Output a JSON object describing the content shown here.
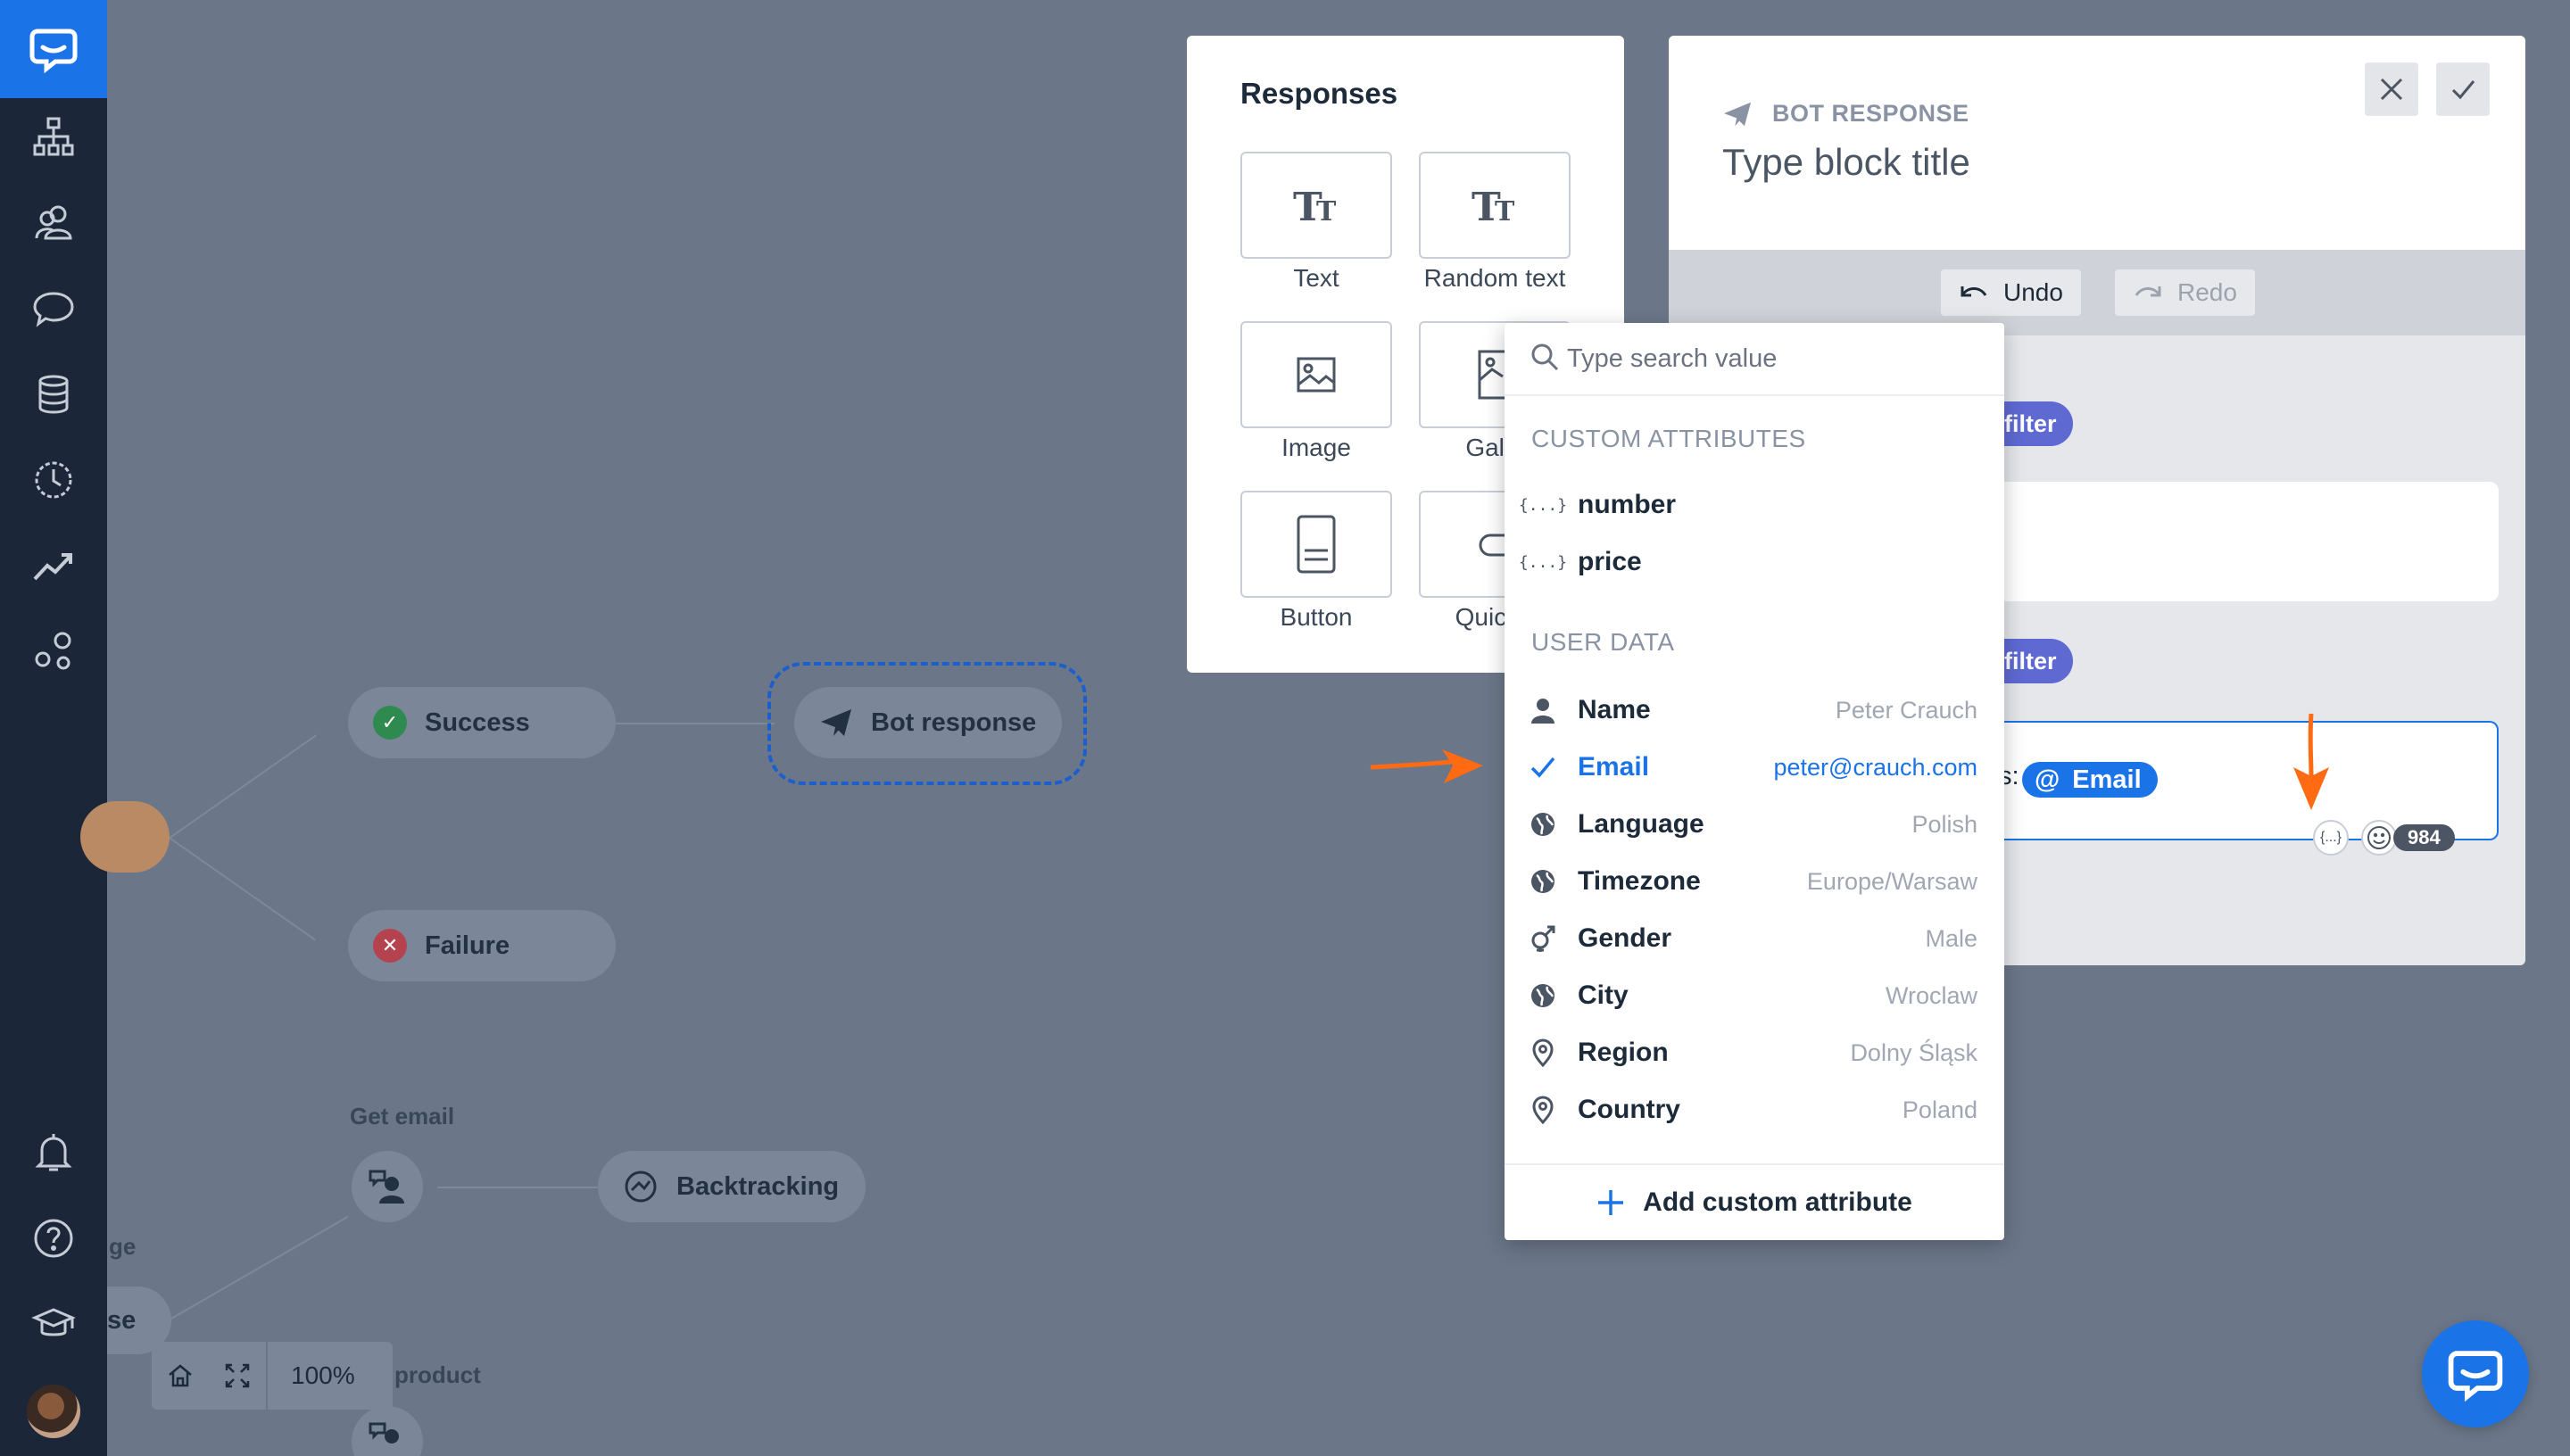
{
  "canvas": {
    "nodes": {
      "success": "Success",
      "failure": "Failure",
      "bot_response": "Bot response",
      "backtracking": "Backtracking"
    },
    "labels": {
      "get_email": "Get email",
      "product": "product",
      "ge": "ge",
      "se": "se"
    },
    "zoom": "100%"
  },
  "responses": {
    "title": "Responses",
    "tiles": [
      {
        "label": "Text",
        "icon": "text-format-icon"
      },
      {
        "label": "Random text",
        "icon": "text-format-icon"
      },
      {
        "label": "Image",
        "icon": "image-icon"
      },
      {
        "label": "Galle",
        "icon": "gallery-icon"
      },
      {
        "label": "Button",
        "icon": "button-icon"
      },
      {
        "label": "Quick r",
        "icon": "quick-reply-icon"
      }
    ]
  },
  "bot_panel": {
    "kind": "BOT RESPONSE",
    "title_placeholder": "Type block title",
    "undo": "Undo",
    "redo": "Redo",
    "filter1": "d filter",
    "filter2": "d filter",
    "prefix": "s:",
    "chip_at": "@",
    "chip_label": "Email",
    "counter": "984",
    "attr_btn": "{...}"
  },
  "dropdown": {
    "search_placeholder": "Type search value",
    "custom_header": "CUSTOM ATTRIBUTES",
    "custom": [
      {
        "label": "number"
      },
      {
        "label": "price"
      }
    ],
    "user_header": "USER DATA",
    "user": [
      {
        "label": "Name",
        "value": "Peter Crauch",
        "icon": "person-icon"
      },
      {
        "label": "Email",
        "value": "peter@crauch.com",
        "icon": "check-icon",
        "selected": true
      },
      {
        "label": "Language",
        "value": "Polish",
        "icon": "globe-icon"
      },
      {
        "label": "Timezone",
        "value": "Europe/Warsaw",
        "icon": "globe-icon"
      },
      {
        "label": "Gender",
        "value": "Male",
        "icon": "gender-icon"
      },
      {
        "label": "City",
        "value": "Wroclaw",
        "icon": "globe-icon"
      },
      {
        "label": "Region",
        "value": "Dolny Śląsk",
        "icon": "location-pin-icon"
      },
      {
        "label": "Country",
        "value": "Poland",
        "icon": "location-pin-icon"
      }
    ],
    "add_label": "Add custom attribute"
  },
  "colors": {
    "brand": "#1b73e8",
    "sidebar": "#1b2739",
    "overlay": "#6b7789",
    "arrow": "#ff6a13",
    "filter_pill": "#5e6ad2"
  }
}
